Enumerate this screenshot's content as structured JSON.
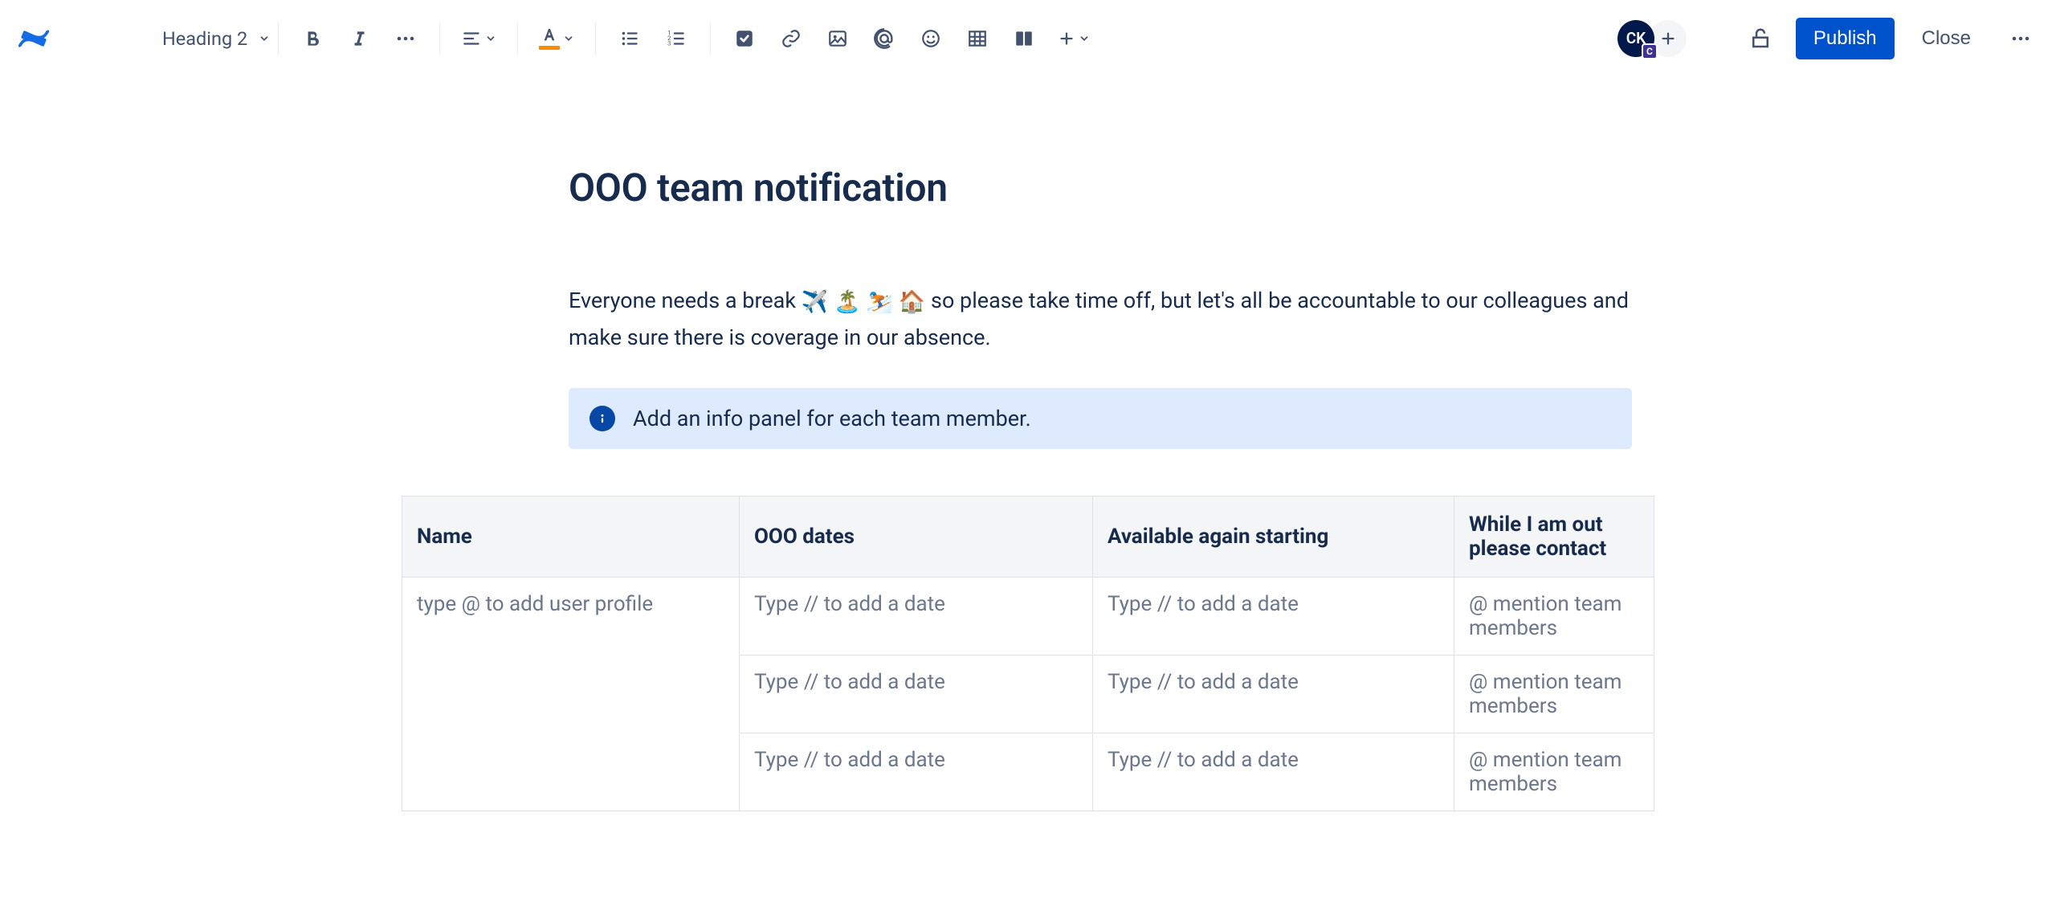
{
  "toolbar": {
    "text_style": "Heading 2",
    "avatar_initials": "CK",
    "avatar_sub": "C",
    "publish_label": "Publish",
    "close_label": "Close"
  },
  "page": {
    "title": "OOO team notification",
    "intro_before": "Everyone needs a break ",
    "intro_emojis": "✈️ 🏝️ ⛷️ 🏠",
    "intro_after": " so please take time off, but let's all be accountable to our colleagues and make sure there is coverage in our absence.",
    "info_panel": "Add an info panel for each team member."
  },
  "table": {
    "headers": {
      "name": "Name",
      "dates": "OOO dates",
      "available": "Available again starting",
      "contact": "While I am out please contact"
    },
    "placeholders": {
      "name": "type @ to add user profile",
      "date": "Type // to add a date",
      "contact": "@ mention team members"
    },
    "row_count": 3
  }
}
